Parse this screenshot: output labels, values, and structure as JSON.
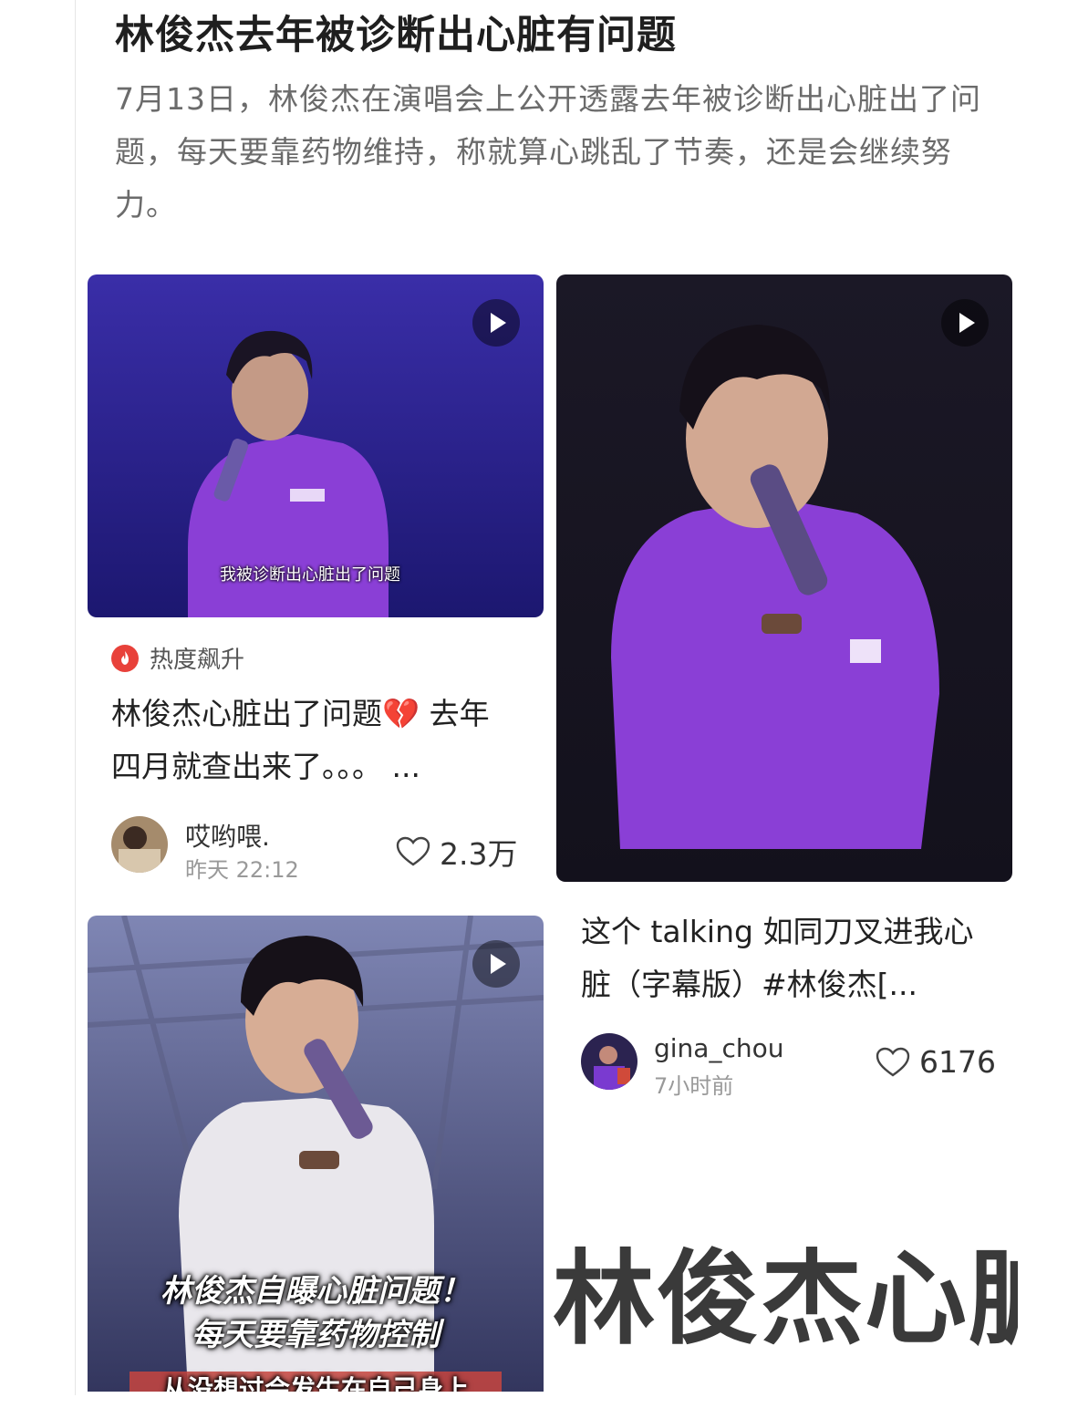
{
  "article": {
    "headline": "林俊杰去年被诊断出心脏有问题",
    "summary": "7月13日，林俊杰在演唱会上公开透露去年被诊断出心脏出了问题，每天要靠药物维持，称就算心跳乱了节奏，还是会继续努力。"
  },
  "cards": [
    {
      "media_caption": "我被诊断出心脏出了问题",
      "badge": "热度飙升",
      "title": "林俊杰心脏出了问题💔 去年四月就查出来了。。。 ...",
      "author": "哎哟喂.",
      "time": "昨天 22:12",
      "likes": "2.3万"
    },
    {
      "title": "这个 talking 如同刀叉进我心脏（字幕版）#林俊杰[...",
      "author": "gina_chou",
      "time": "7小时前",
      "likes": "6176"
    },
    {
      "caption_line1": "林俊杰自曝心脏问题！",
      "caption_line2": "每天要靠药物控制",
      "caption_line3": "从没想过会发生在自己身上"
    }
  ],
  "watermark": "林俊杰心脏",
  "icons": {
    "play": "play-icon",
    "fire": "fire-icon",
    "heart": "heart-outline-icon"
  },
  "colors": {
    "stage_purple": "#4a2fb0",
    "shirt_purple": "#8a3fd6",
    "hot_red": "#e8413a"
  }
}
